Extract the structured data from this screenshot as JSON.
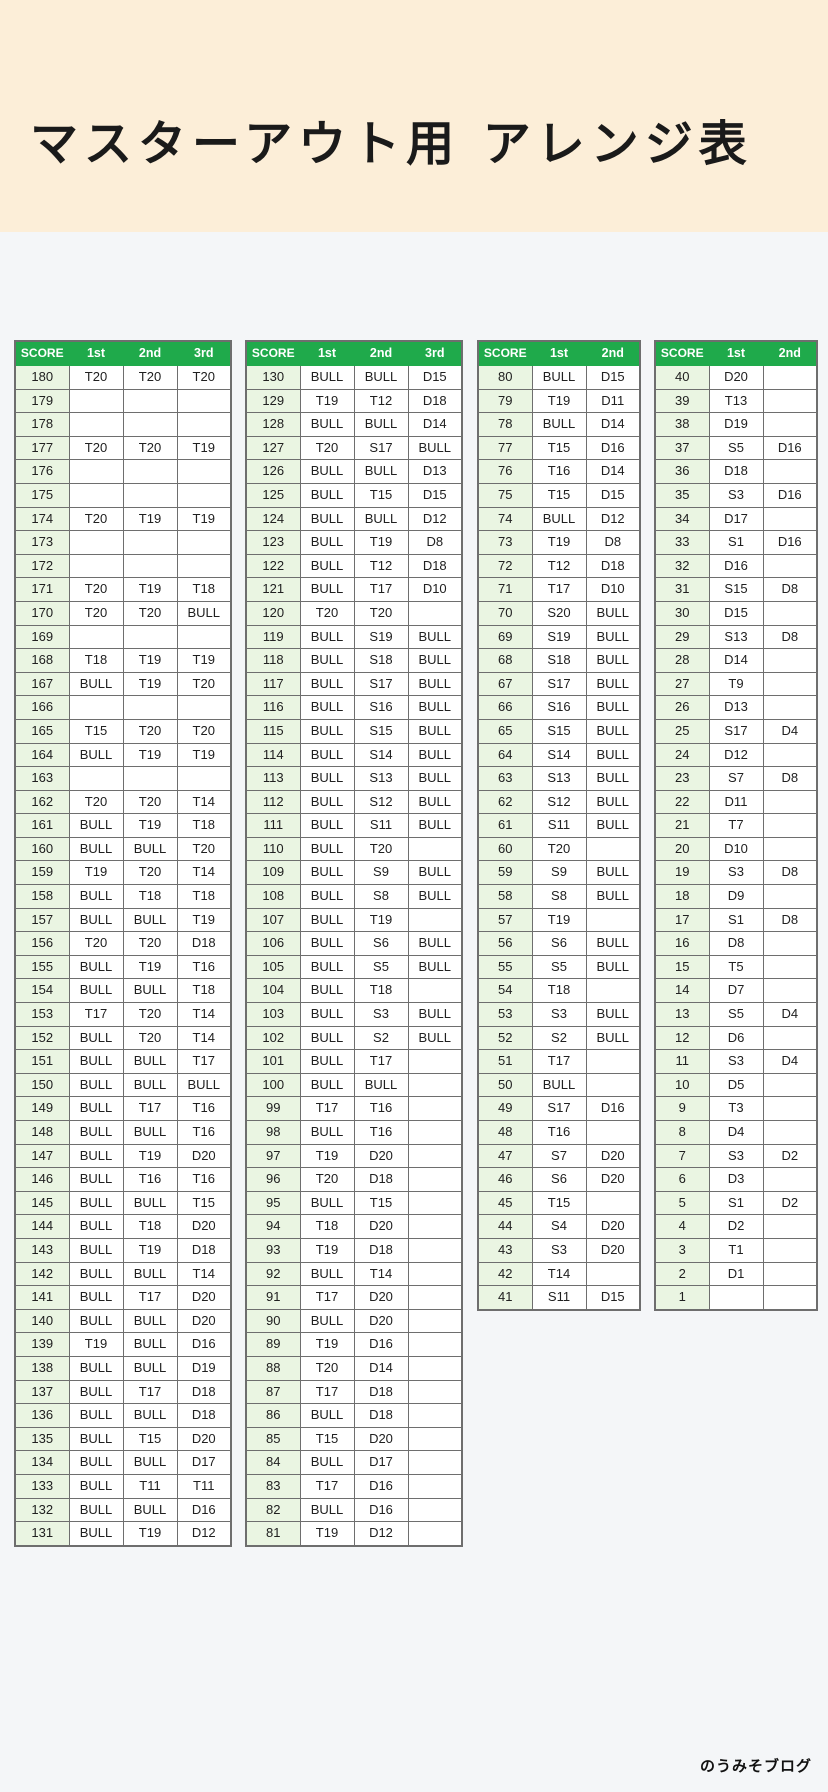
{
  "header": {
    "title": "マスターアウト用 アレンジ表",
    "background_color": "#fceed8"
  },
  "footer": {
    "credit": "のうみそブログ"
  },
  "theme": {
    "header_green": "#1faa4b",
    "score_cell_green": "#eaf5e2",
    "page_background": "#f4f6f8",
    "border_gray": "#6e6e6e"
  },
  "tables": [
    {
      "id": "table-180-131",
      "columns": [
        "SCORE",
        "1st",
        "2nd",
        "3rd"
      ],
      "rows": [
        [
          "180",
          "T20",
          "T20",
          "T20"
        ],
        [
          "179",
          "",
          "",
          ""
        ],
        [
          "178",
          "",
          "",
          ""
        ],
        [
          "177",
          "T20",
          "T20",
          "T19"
        ],
        [
          "176",
          "",
          "",
          ""
        ],
        [
          "175",
          "",
          "",
          ""
        ],
        [
          "174",
          "T20",
          "T19",
          "T19"
        ],
        [
          "173",
          "",
          "",
          ""
        ],
        [
          "172",
          "",
          "",
          ""
        ],
        [
          "171",
          "T20",
          "T19",
          "T18"
        ],
        [
          "170",
          "T20",
          "T20",
          "BULL"
        ],
        [
          "169",
          "",
          "",
          ""
        ],
        [
          "168",
          "T18",
          "T19",
          "T19"
        ],
        [
          "167",
          "BULL",
          "T19",
          "T20"
        ],
        [
          "166",
          "",
          "",
          ""
        ],
        [
          "165",
          "T15",
          "T20",
          "T20"
        ],
        [
          "164",
          "BULL",
          "T19",
          "T19"
        ],
        [
          "163",
          "",
          "",
          ""
        ],
        [
          "162",
          "T20",
          "T20",
          "T14"
        ],
        [
          "161",
          "BULL",
          "T19",
          "T18"
        ],
        [
          "160",
          "BULL",
          "BULL",
          "T20"
        ],
        [
          "159",
          "T19",
          "T20",
          "T14"
        ],
        [
          "158",
          "BULL",
          "T18",
          "T18"
        ],
        [
          "157",
          "BULL",
          "BULL",
          "T19"
        ],
        [
          "156",
          "T20",
          "T20",
          "D18"
        ],
        [
          "155",
          "BULL",
          "T19",
          "T16"
        ],
        [
          "154",
          "BULL",
          "BULL",
          "T18"
        ],
        [
          "153",
          "T17",
          "T20",
          "T14"
        ],
        [
          "152",
          "BULL",
          "T20",
          "T14"
        ],
        [
          "151",
          "BULL",
          "BULL",
          "T17"
        ],
        [
          "150",
          "BULL",
          "BULL",
          "BULL"
        ],
        [
          "149",
          "BULL",
          "T17",
          "T16"
        ],
        [
          "148",
          "BULL",
          "BULL",
          "T16"
        ],
        [
          "147",
          "BULL",
          "T19",
          "D20"
        ],
        [
          "146",
          "BULL",
          "T16",
          "T16"
        ],
        [
          "145",
          "BULL",
          "BULL",
          "T15"
        ],
        [
          "144",
          "BULL",
          "T18",
          "D20"
        ],
        [
          "143",
          "BULL",
          "T19",
          "D18"
        ],
        [
          "142",
          "BULL",
          "BULL",
          "T14"
        ],
        [
          "141",
          "BULL",
          "T17",
          "D20"
        ],
        [
          "140",
          "BULL",
          "BULL",
          "D20"
        ],
        [
          "139",
          "T19",
          "BULL",
          "D16"
        ],
        [
          "138",
          "BULL",
          "BULL",
          "D19"
        ],
        [
          "137",
          "BULL",
          "T17",
          "D18"
        ],
        [
          "136",
          "BULL",
          "BULL",
          "D18"
        ],
        [
          "135",
          "BULL",
          "T15",
          "D20"
        ],
        [
          "134",
          "BULL",
          "BULL",
          "D17"
        ],
        [
          "133",
          "BULL",
          "T11",
          "T11"
        ],
        [
          "132",
          "BULL",
          "BULL",
          "D16"
        ],
        [
          "131",
          "BULL",
          "T19",
          "D12"
        ]
      ]
    },
    {
      "id": "table-130-81",
      "columns": [
        "SCORE",
        "1st",
        "2nd",
        "3rd"
      ],
      "rows": [
        [
          "130",
          "BULL",
          "BULL",
          "D15"
        ],
        [
          "129",
          "T19",
          "T12",
          "D18"
        ],
        [
          "128",
          "BULL",
          "BULL",
          "D14"
        ],
        [
          "127",
          "T20",
          "S17",
          "BULL"
        ],
        [
          "126",
          "BULL",
          "BULL",
          "D13"
        ],
        [
          "125",
          "BULL",
          "T15",
          "D15"
        ],
        [
          "124",
          "BULL",
          "BULL",
          "D12"
        ],
        [
          "123",
          "BULL",
          "T19",
          "D8"
        ],
        [
          "122",
          "BULL",
          "T12",
          "D18"
        ],
        [
          "121",
          "BULL",
          "T17",
          "D10"
        ],
        [
          "120",
          "T20",
          "T20",
          ""
        ],
        [
          "119",
          "BULL",
          "S19",
          "BULL"
        ],
        [
          "118",
          "BULL",
          "S18",
          "BULL"
        ],
        [
          "117",
          "BULL",
          "S17",
          "BULL"
        ],
        [
          "116",
          "BULL",
          "S16",
          "BULL"
        ],
        [
          "115",
          "BULL",
          "S15",
          "BULL"
        ],
        [
          "114",
          "BULL",
          "S14",
          "BULL"
        ],
        [
          "113",
          "BULL",
          "S13",
          "BULL"
        ],
        [
          "112",
          "BULL",
          "S12",
          "BULL"
        ],
        [
          "111",
          "BULL",
          "S11",
          "BULL"
        ],
        [
          "110",
          "BULL",
          "T20",
          ""
        ],
        [
          "109",
          "BULL",
          "S9",
          "BULL"
        ],
        [
          "108",
          "BULL",
          "S8",
          "BULL"
        ],
        [
          "107",
          "BULL",
          "T19",
          ""
        ],
        [
          "106",
          "BULL",
          "S6",
          "BULL"
        ],
        [
          "105",
          "BULL",
          "S5",
          "BULL"
        ],
        [
          "104",
          "BULL",
          "T18",
          ""
        ],
        [
          "103",
          "BULL",
          "S3",
          "BULL"
        ],
        [
          "102",
          "BULL",
          "S2",
          "BULL"
        ],
        [
          "101",
          "BULL",
          "T17",
          ""
        ],
        [
          "100",
          "BULL",
          "BULL",
          ""
        ],
        [
          "99",
          "T17",
          "T16",
          ""
        ],
        [
          "98",
          "BULL",
          "T16",
          ""
        ],
        [
          "97",
          "T19",
          "D20",
          ""
        ],
        [
          "96",
          "T20",
          "D18",
          ""
        ],
        [
          "95",
          "BULL",
          "T15",
          ""
        ],
        [
          "94",
          "T18",
          "D20",
          ""
        ],
        [
          "93",
          "T19",
          "D18",
          ""
        ],
        [
          "92",
          "BULL",
          "T14",
          ""
        ],
        [
          "91",
          "T17",
          "D20",
          ""
        ],
        [
          "90",
          "BULL",
          "D20",
          ""
        ],
        [
          "89",
          "T19",
          "D16",
          ""
        ],
        [
          "88",
          "T20",
          "D14",
          ""
        ],
        [
          "87",
          "T17",
          "D18",
          ""
        ],
        [
          "86",
          "BULL",
          "D18",
          ""
        ],
        [
          "85",
          "T15",
          "D20",
          ""
        ],
        [
          "84",
          "BULL",
          "D17",
          ""
        ],
        [
          "83",
          "T17",
          "D16",
          ""
        ],
        [
          "82",
          "BULL",
          "D16",
          ""
        ],
        [
          "81",
          "T19",
          "D12",
          ""
        ]
      ]
    },
    {
      "id": "table-80-41",
      "columns": [
        "SCORE",
        "1st",
        "2nd"
      ],
      "rows": [
        [
          "80",
          "BULL",
          "D15"
        ],
        [
          "79",
          "T19",
          "D11"
        ],
        [
          "78",
          "BULL",
          "D14"
        ],
        [
          "77",
          "T15",
          "D16"
        ],
        [
          "76",
          "T16",
          "D14"
        ],
        [
          "75",
          "T15",
          "D15"
        ],
        [
          "74",
          "BULL",
          "D12"
        ],
        [
          "73",
          "T19",
          "D8"
        ],
        [
          "72",
          "T12",
          "D18"
        ],
        [
          "71",
          "T17",
          "D10"
        ],
        [
          "70",
          "S20",
          "BULL"
        ],
        [
          "69",
          "S19",
          "BULL"
        ],
        [
          "68",
          "S18",
          "BULL"
        ],
        [
          "67",
          "S17",
          "BULL"
        ],
        [
          "66",
          "S16",
          "BULL"
        ],
        [
          "65",
          "S15",
          "BULL"
        ],
        [
          "64",
          "S14",
          "BULL"
        ],
        [
          "63",
          "S13",
          "BULL"
        ],
        [
          "62",
          "S12",
          "BULL"
        ],
        [
          "61",
          "S11",
          "BULL"
        ],
        [
          "60",
          "T20",
          ""
        ],
        [
          "59",
          "S9",
          "BULL"
        ],
        [
          "58",
          "S8",
          "BULL"
        ],
        [
          "57",
          "T19",
          ""
        ],
        [
          "56",
          "S6",
          "BULL"
        ],
        [
          "55",
          "S5",
          "BULL"
        ],
        [
          "54",
          "T18",
          ""
        ],
        [
          "53",
          "S3",
          "BULL"
        ],
        [
          "52",
          "S2",
          "BULL"
        ],
        [
          "51",
          "T17",
          ""
        ],
        [
          "50",
          "BULL",
          ""
        ],
        [
          "49",
          "S17",
          "D16"
        ],
        [
          "48",
          "T16",
          ""
        ],
        [
          "47",
          "S7",
          "D20"
        ],
        [
          "46",
          "S6",
          "D20"
        ],
        [
          "45",
          "T15",
          ""
        ],
        [
          "44",
          "S4",
          "D20"
        ],
        [
          "43",
          "S3",
          "D20"
        ],
        [
          "42",
          "T14",
          ""
        ],
        [
          "41",
          "S11",
          "D15"
        ]
      ]
    },
    {
      "id": "table-40-1",
      "columns": [
        "SCORE",
        "1st",
        "2nd"
      ],
      "rows": [
        [
          "40",
          "D20",
          ""
        ],
        [
          "39",
          "T13",
          ""
        ],
        [
          "38",
          "D19",
          ""
        ],
        [
          "37",
          "S5",
          "D16"
        ],
        [
          "36",
          "D18",
          ""
        ],
        [
          "35",
          "S3",
          "D16"
        ],
        [
          "34",
          "D17",
          ""
        ],
        [
          "33",
          "S1",
          "D16"
        ],
        [
          "32",
          "D16",
          ""
        ],
        [
          "31",
          "S15",
          "D8"
        ],
        [
          "30",
          "D15",
          ""
        ],
        [
          "29",
          "S13",
          "D8"
        ],
        [
          "28",
          "D14",
          ""
        ],
        [
          "27",
          "T9",
          ""
        ],
        [
          "26",
          "D13",
          ""
        ],
        [
          "25",
          "S17",
          "D4"
        ],
        [
          "24",
          "D12",
          ""
        ],
        [
          "23",
          "S7",
          "D8"
        ],
        [
          "22",
          "D11",
          ""
        ],
        [
          "21",
          "T7",
          ""
        ],
        [
          "20",
          "D10",
          ""
        ],
        [
          "19",
          "S3",
          "D8"
        ],
        [
          "18",
          "D9",
          ""
        ],
        [
          "17",
          "S1",
          "D8"
        ],
        [
          "16",
          "D8",
          ""
        ],
        [
          "15",
          "T5",
          ""
        ],
        [
          "14",
          "D7",
          ""
        ],
        [
          "13",
          "S5",
          "D4"
        ],
        [
          "12",
          "D6",
          ""
        ],
        [
          "11",
          "S3",
          "D4"
        ],
        [
          "10",
          "D5",
          ""
        ],
        [
          "9",
          "T3",
          ""
        ],
        [
          "8",
          "D4",
          ""
        ],
        [
          "7",
          "S3",
          "D2"
        ],
        [
          "6",
          "D3",
          ""
        ],
        [
          "5",
          "S1",
          "D2"
        ],
        [
          "4",
          "D2",
          ""
        ],
        [
          "3",
          "T1",
          ""
        ],
        [
          "2",
          "D1",
          ""
        ],
        [
          "1",
          "",
          ""
        ]
      ]
    }
  ]
}
